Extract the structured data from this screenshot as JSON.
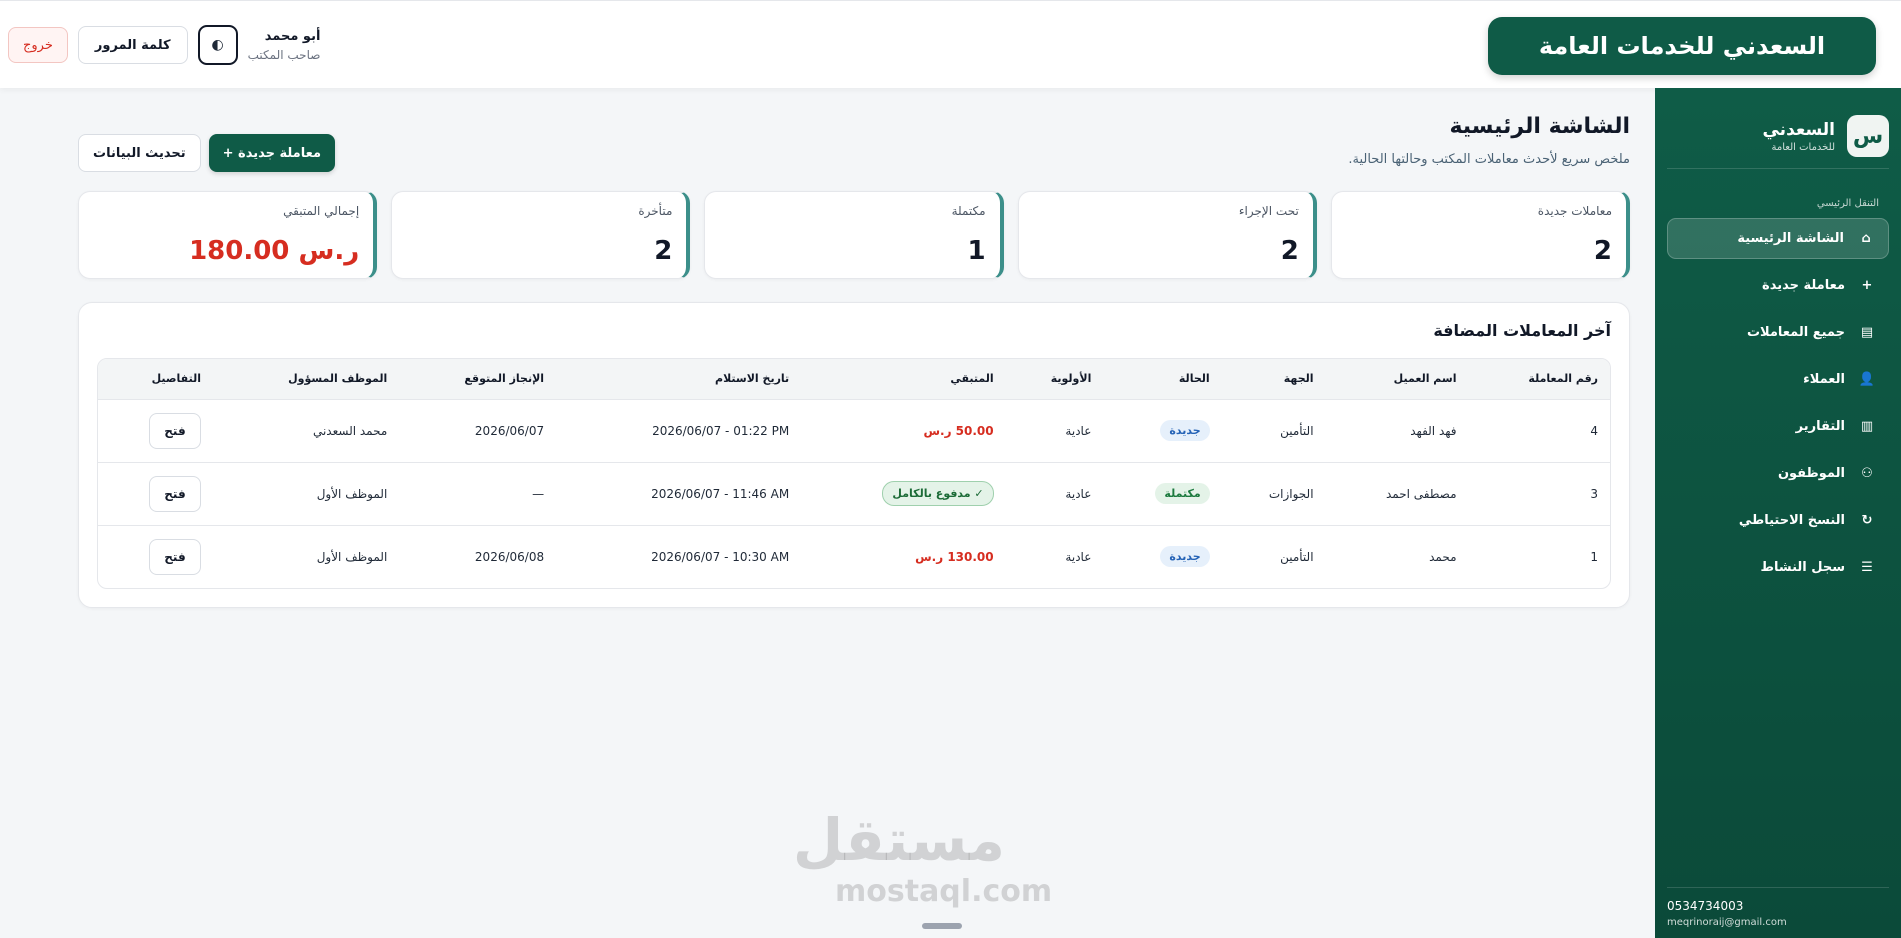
{
  "header": {
    "brand_title": "السعدني للخدمات العامة",
    "user_name": "أبو محمد",
    "user_role": "صاحب المكتب",
    "theme_icon": "◐",
    "password_label": "كلمة المرور",
    "logout_label": "خروج"
  },
  "sidebar": {
    "logo_letter": "س",
    "brand_name": "السعدني",
    "brand_sub": "للخدمات العامة",
    "section_label": "التنقل الرئيسي",
    "items": [
      {
        "label": "الشاشة الرئيسية",
        "icon": "⌂",
        "icon_name": "home-icon",
        "active": true
      },
      {
        "label": "معاملة جديدة",
        "icon": "+",
        "icon_name": "plus-icon",
        "active": false
      },
      {
        "label": "جميع المعاملات",
        "icon": "▤",
        "icon_name": "list-icon",
        "active": false
      },
      {
        "label": "العملاء",
        "icon": "👤",
        "icon_name": "user-icon",
        "active": false
      },
      {
        "label": "التقارير",
        "icon": "▥",
        "icon_name": "chart-icon",
        "active": false
      },
      {
        "label": "الموظفون",
        "icon": "⚇",
        "icon_name": "staff-icon",
        "active": false
      },
      {
        "label": "النسخ الاحتياطي",
        "icon": "↻",
        "icon_name": "backup-icon",
        "active": false
      },
      {
        "label": "سجل النشاط",
        "icon": "☰",
        "icon_name": "activity-icon",
        "active": false
      }
    ],
    "phone": "0534734003",
    "email": "meqrinoraij@gmail.com"
  },
  "main": {
    "title": "الشاشة الرئيسية",
    "subtitle": "ملخص سريع لأحدث معاملات المكتب وحالتها الحالية.",
    "new_button": "+ معاملة جديدة",
    "refresh_button": "تحديث البيانات"
  },
  "stats": [
    {
      "label": "معاملات جديدة",
      "value": "2",
      "red": false
    },
    {
      "label": "تحت الإجراء",
      "value": "2",
      "red": false
    },
    {
      "label": "مكتملة",
      "value": "1",
      "red": false
    },
    {
      "label": "متأخرة",
      "value": "2",
      "red": false
    },
    {
      "label": "إجمالي المتبقي",
      "value": "180.00 ر.س",
      "red": true
    }
  ],
  "table": {
    "title": "آخر المعاملات المضافة",
    "columns": [
      "رقم المعاملة",
      "اسم العميل",
      "الجهة",
      "الحالة",
      "الأولوية",
      "المتبقي",
      "تاريخ الاستلام",
      "الإنجاز المتوقع",
      "الموظف المسؤول",
      "التفاصيل"
    ],
    "rows": [
      {
        "id": "4",
        "client": "فهد الفهد",
        "entity": "التأمين",
        "status": "جديدة",
        "status_type": "new",
        "priority": "عادية",
        "remaining": "50.00 ر.س",
        "remaining_type": "amount",
        "received": "2026/06/07 - 01:22 PM",
        "expected": "2026/06/07",
        "employee": "محمد السعدني",
        "action": "فتح"
      },
      {
        "id": "3",
        "client": "مصطفى احمد",
        "entity": "الجوازات",
        "status": "مكتملة",
        "status_type": "done",
        "priority": "عادية",
        "remaining": "✓ مدفوع بالكامل",
        "remaining_type": "paid",
        "received": "2026/06/07 - 11:46 AM",
        "expected": "—",
        "employee": "الموظف الأول",
        "action": "فتح"
      },
      {
        "id": "1",
        "client": "محمد",
        "entity": "التأمين",
        "status": "جديدة",
        "status_type": "new",
        "priority": "عادية",
        "remaining": "130.00 ر.س",
        "remaining_type": "amount",
        "received": "2026/06/07 - 10:30 AM",
        "expected": "2026/06/08",
        "employee": "الموظف الأول",
        "action": "فتح"
      }
    ]
  },
  "watermark": {
    "arabic": "مستقل",
    "latin": "mostaql.com"
  }
}
